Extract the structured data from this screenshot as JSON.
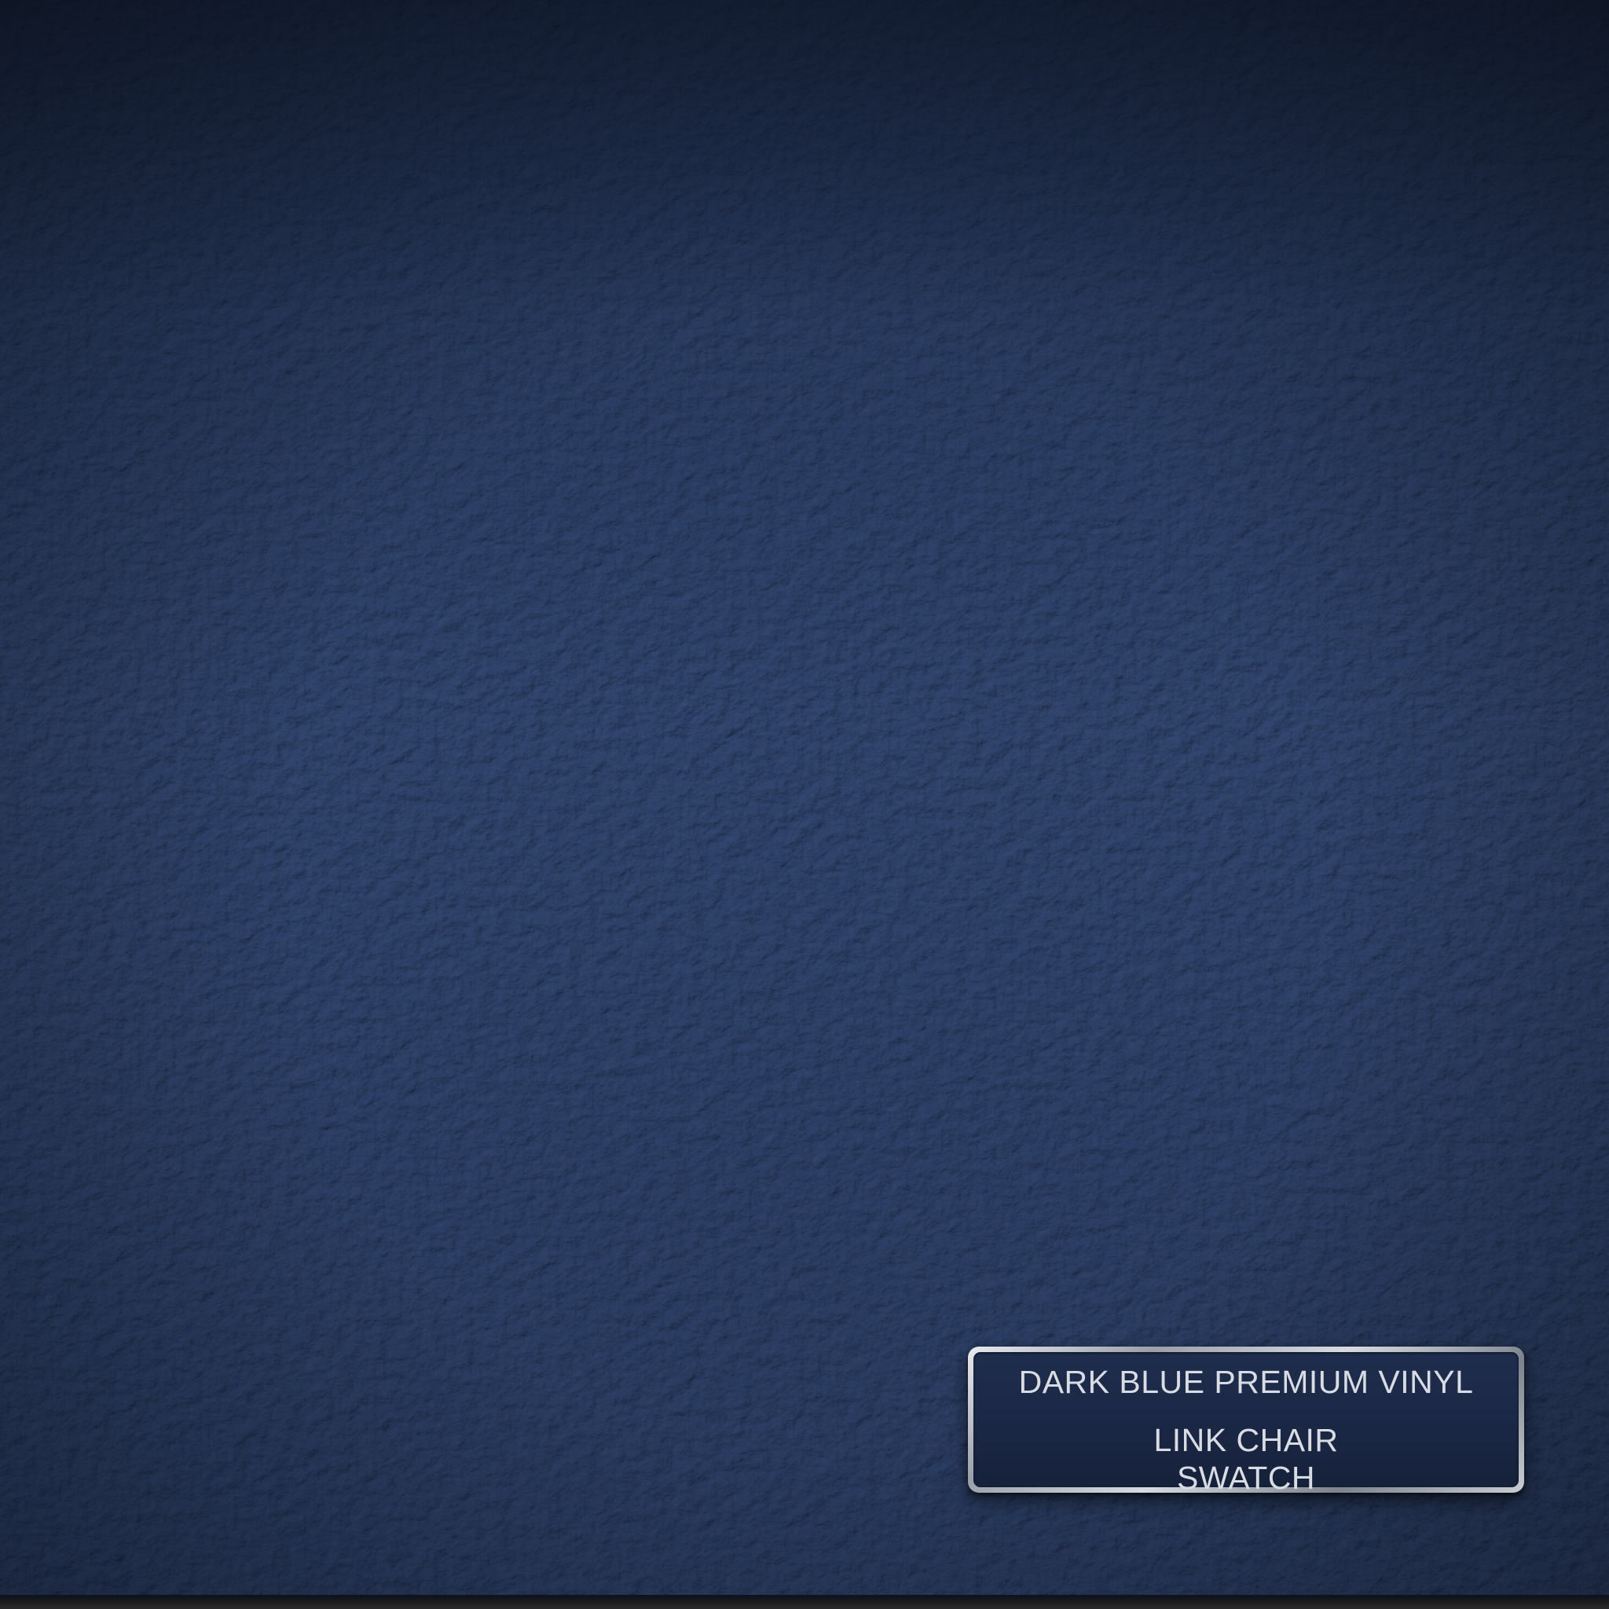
{
  "scene": {
    "surface_color": "#223354",
    "plate_face_color": "#1b2846",
    "plate_frame_color": "#c9cdd3"
  },
  "nameplate": {
    "title": "DARK BLUE PREMIUM VINYL",
    "line1": "LINK CHAIR",
    "line2": "SWATCH"
  }
}
